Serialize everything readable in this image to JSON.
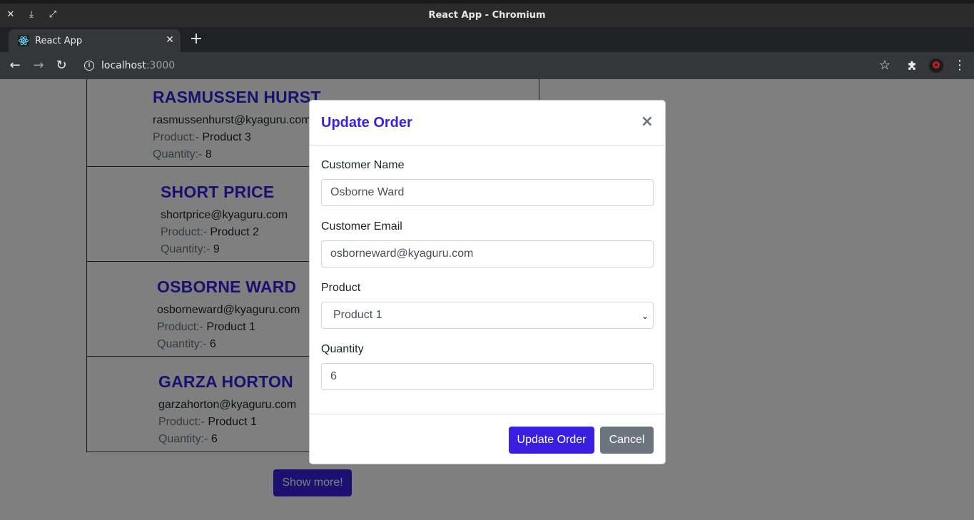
{
  "window": {
    "title": "React App - Chromium"
  },
  "tab": {
    "title": "React App"
  },
  "address": {
    "host": "localhost",
    "port": ":3000"
  },
  "orders": [
    {
      "name": "RASMUSSEN HURST",
      "email": "rasmussenhurst@kyaguru.com",
      "product_label": "Product:-",
      "product": "Product 3",
      "quantity_label": "Quantity:-",
      "quantity": "8"
    },
    {
      "name": "SHORT PRICE",
      "email": "shortprice@kyaguru.com",
      "product_label": "Product:-",
      "product": "Product 2",
      "quantity_label": "Quantity:-",
      "quantity": "9"
    },
    {
      "name": "OSBORNE WARD",
      "email": "osborneward@kyaguru.com",
      "product_label": "Product:-",
      "product": "Product 1",
      "quantity_label": "Quantity:-",
      "quantity": "6"
    },
    {
      "name": "GARZA HORTON",
      "email": "garzahorton@kyaguru.com",
      "product_label": "Product:-",
      "product": "Product 1",
      "quantity_label": "Quantity:-",
      "quantity": "6"
    }
  ],
  "show_more_label": "Show more!",
  "modal": {
    "title": "Update Order",
    "close": "×",
    "fields": {
      "name": {
        "label": "Customer Name",
        "value": "Osborne Ward"
      },
      "email": {
        "label": "Customer Email",
        "value": "osborneward@kyaguru.com"
      },
      "product": {
        "label": "Product",
        "value": "Product 1"
      },
      "quantity": {
        "label": "Quantity",
        "value": "6"
      }
    },
    "update_label": "Update Order",
    "cancel_label": "Cancel"
  },
  "colors": {
    "accent": "#3a1fe0",
    "secondary": "#6c757d"
  }
}
